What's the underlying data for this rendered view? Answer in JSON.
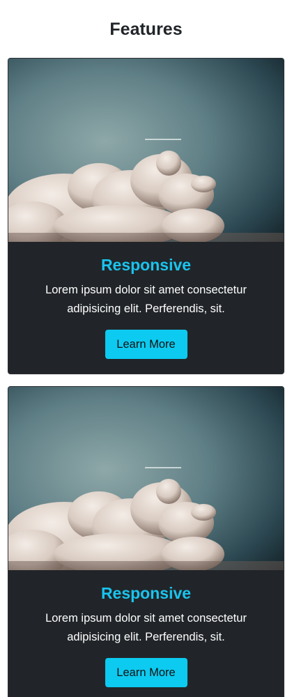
{
  "section": {
    "title": "Features"
  },
  "cards": [
    {
      "image_alt": "clouds-image",
      "title": "Responsive",
      "text": "Lorem ipsum dolor sit amet consectetur adipisicing elit. Perferendis, sit.",
      "button_label": "Learn More"
    },
    {
      "image_alt": "clouds-image",
      "title": "Responsive",
      "text": "Lorem ipsum dolor sit amet consectetur adipisicing elit. Perferendis, sit.",
      "button_label": "Learn More"
    }
  ],
  "colors": {
    "card_bg": "#212529",
    "accent": "#19c4ee",
    "button_bg": "#0dcaf0"
  }
}
